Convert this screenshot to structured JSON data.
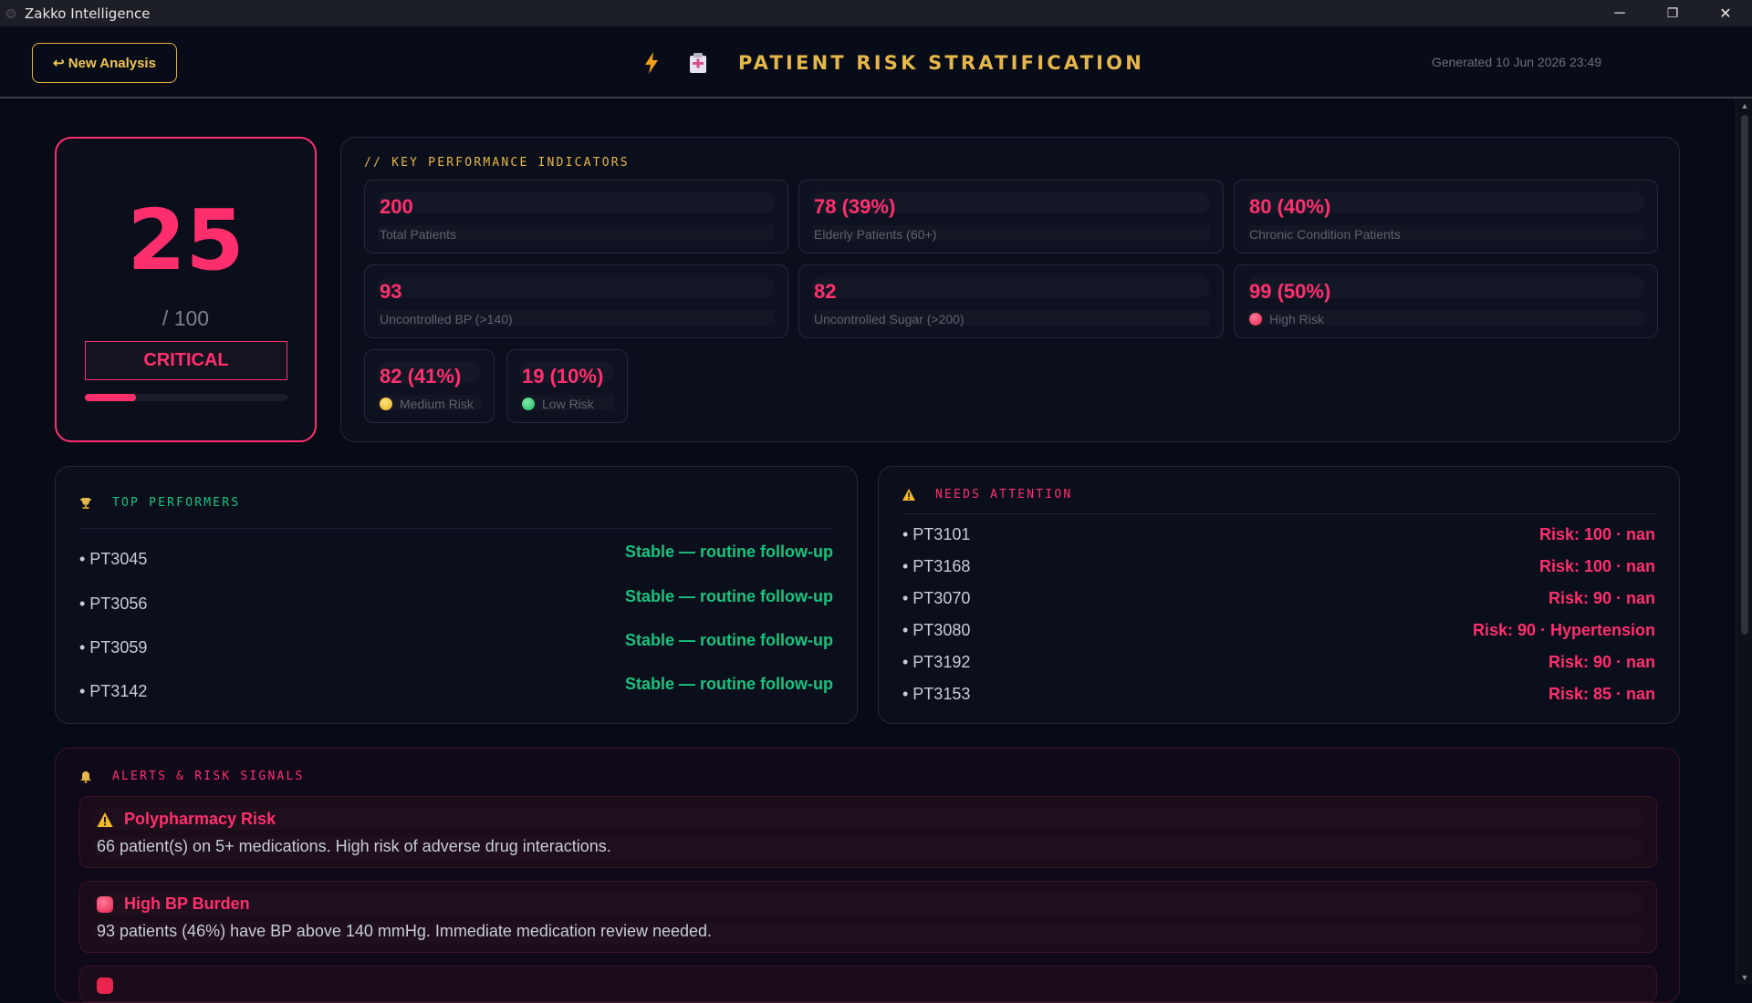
{
  "window": {
    "title": "Zakko Intelligence",
    "minimize": "─",
    "maximize": "❐",
    "close": "✕"
  },
  "header": {
    "new_button": "↩ New Analysis",
    "title": "PATIENT RISK STRATIFICATION",
    "generated": "Generated 10 Jun 2026  23:49"
  },
  "score": {
    "value": "25",
    "max": "/ 100",
    "label": "CRITICAL",
    "fraction": 0.25,
    "color": "#ff2f6e"
  },
  "kpi": {
    "heading": "// KEY PERFORMANCE INDICATORS",
    "cards": [
      {
        "value": "200",
        "label": "Total Patients"
      },
      {
        "value": "78 (39%)",
        "label": "Elderly Patients (60+)"
      },
      {
        "value": "80 (40%)",
        "label": "Chronic Condition Patients"
      },
      {
        "value": "93",
        "label": "Uncontrolled BP (>140)"
      },
      {
        "value": "82",
        "label": "Uncontrolled Sugar (>200)"
      },
      {
        "value": "99 (50%)",
        "label": "High Risk",
        "dot": "red"
      },
      {
        "value": "82 (41%)",
        "label": "Medium Risk",
        "dot": "yellow"
      },
      {
        "value": "19 (10%)",
        "label": "Low Risk",
        "dot": "green"
      }
    ]
  },
  "top_performers": {
    "heading": "TOP PERFORMERS",
    "icon": "trophy-icon",
    "rows": [
      {
        "id": "• PT3045",
        "status": "Stable — routine follow-up"
      },
      {
        "id": "• PT3056",
        "status": "Stable — routine follow-up"
      },
      {
        "id": "• PT3059",
        "status": "Stable — routine follow-up"
      },
      {
        "id": "• PT3142",
        "status": "Stable — routine follow-up"
      }
    ]
  },
  "needs_attention": {
    "heading": "NEEDS ATTENTION",
    "icon": "warning-icon",
    "rows": [
      {
        "id": "• PT3101",
        "status": "Risk: 100 · nan"
      },
      {
        "id": "• PT3168",
        "status": "Risk: 100 · nan"
      },
      {
        "id": "• PT3070",
        "status": "Risk: 90 · nan"
      },
      {
        "id": "• PT3080",
        "status": "Risk: 90 · Hypertension"
      },
      {
        "id": "• PT3192",
        "status": "Risk: 90 · nan"
      },
      {
        "id": "• PT3153",
        "status": "Risk: 85 · nan"
      }
    ]
  },
  "alerts": {
    "heading": "ALERTS & RISK SIGNALS",
    "icon": "bell-icon",
    "items": [
      {
        "icon": "warning-icon",
        "title": "Polypharmacy Risk",
        "text": "66 patient(s) on 5+ medications. High risk of adverse drug interactions."
      },
      {
        "icon": "red-circle-icon",
        "title": "High BP Burden",
        "text": "93 patients (46%) have BP above 140 mmHg. Immediate medication review needed."
      }
    ]
  },
  "colors": {
    "accent": "#e5b64a",
    "danger": "#ff2f6e",
    "success": "#19c37d",
    "background": "#070b16"
  }
}
